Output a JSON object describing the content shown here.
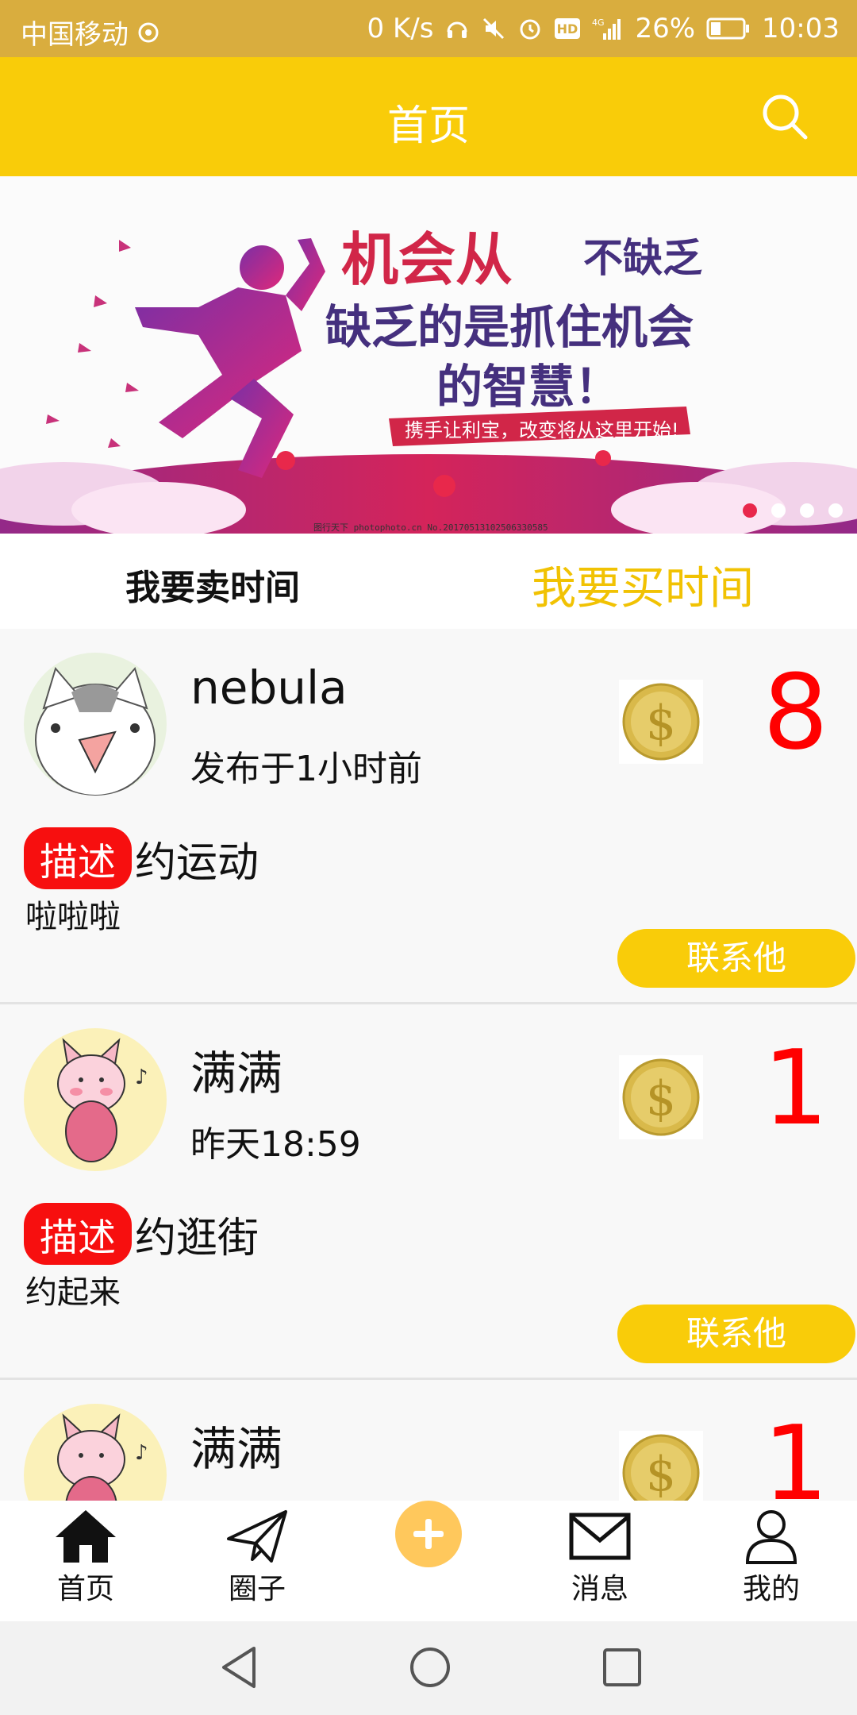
{
  "status_bar": {
    "carrier": "中国移动",
    "speed": "0 K/s",
    "network": "4G",
    "battery": "26%",
    "time": "10:03"
  },
  "header": {
    "title": "首页"
  },
  "banner": {
    "dots": 4,
    "active_dot": 0,
    "headline_line1_a": "机会从",
    "headline_line1_b": "不缺乏",
    "headline_line2": "缺乏的是抓住机会",
    "headline_line3": "的智慧！",
    "slogan": "携手让利宝，改变将从这里开始!",
    "watermark": "图行天下 photophoto.cn No.20170513102506330585"
  },
  "tabs": {
    "sell": "我要卖时间",
    "buy": "我要买时间"
  },
  "posts": [
    {
      "username": "nebula",
      "time": "发布于1小时前",
      "amount": "8",
      "badge": "描述",
      "title": "约运动",
      "body": "啦啦啦",
      "contact": "联系他"
    },
    {
      "username": "满满",
      "time": "昨天18:59",
      "amount": "1",
      "badge": "描述",
      "title": "约逛街",
      "body": "约起来",
      "contact": "联系他"
    },
    {
      "username": "满满",
      "time": "",
      "amount": "1",
      "badge": "",
      "title": "",
      "body": "",
      "contact": ""
    }
  ],
  "bottom_nav": {
    "home": "首页",
    "circle": "圈子",
    "messages": "消息",
    "mine": "我的"
  },
  "colors": {
    "accent": "#f9cc09",
    "status_bar": "#d9ad3e",
    "badge": "#f70f0f",
    "amount": "#ff0000"
  }
}
